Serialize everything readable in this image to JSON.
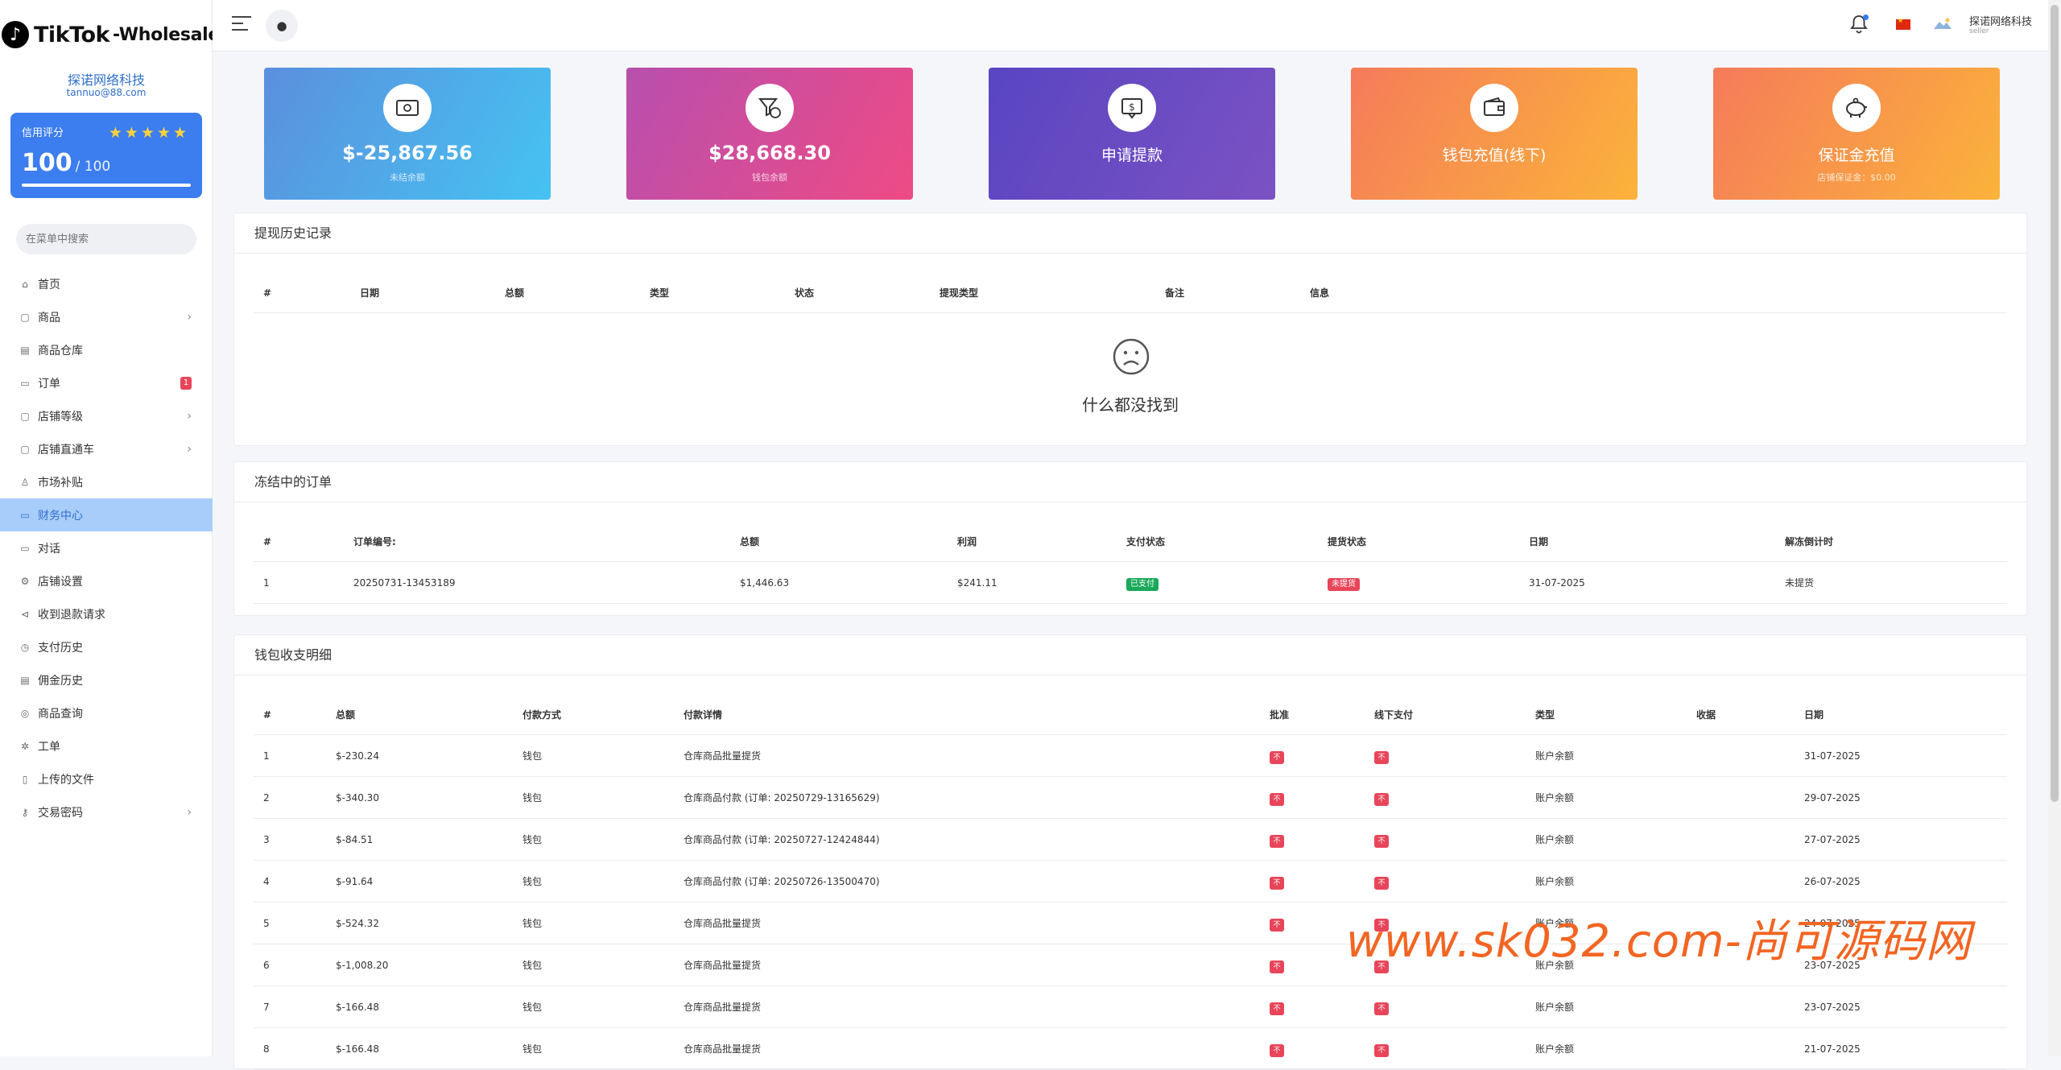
{
  "brand": {
    "word": "TikTok",
    "suffix": "-Wholesale"
  },
  "profile": {
    "name": "探诺网络科技",
    "email": "tannuo@88.com"
  },
  "credit": {
    "label": "信用评分",
    "stars": "★★★★★",
    "score": "100",
    "max": "/ 100",
    "progress_percent": 100
  },
  "search": {
    "placeholder": "在菜单中搜索"
  },
  "menu": [
    {
      "label": "首页",
      "icon": "home-icon",
      "glyph": "⌂"
    },
    {
      "label": "商品",
      "icon": "bag-icon",
      "glyph": "▢",
      "chevron": "›"
    },
    {
      "label": "商品仓库",
      "icon": "warehouse-icon",
      "glyph": "▤"
    },
    {
      "label": "订单",
      "icon": "order-icon",
      "glyph": "▭",
      "badge": "1"
    },
    {
      "label": "店铺等级",
      "icon": "level-icon",
      "glyph": "▢",
      "chevron": "›"
    },
    {
      "label": "店铺直通车",
      "icon": "promotion-icon",
      "glyph": "▢",
      "chevron": "›"
    },
    {
      "label": "市场补贴",
      "icon": "subsidy-icon",
      "glyph": "♙"
    },
    {
      "label": "财务中心",
      "icon": "finance-icon",
      "glyph": "▭",
      "active": true
    },
    {
      "label": "对话",
      "icon": "chat-icon",
      "glyph": "▭"
    },
    {
      "label": "店铺设置",
      "icon": "settings-icon",
      "glyph": "⚙"
    },
    {
      "label": "收到退款请求",
      "icon": "refund-icon",
      "glyph": "⊲"
    },
    {
      "label": "支付历史",
      "icon": "history-icon",
      "glyph": "◷"
    },
    {
      "label": "佣金历史",
      "icon": "commission-icon",
      "glyph": "▤"
    },
    {
      "label": "商品查询",
      "icon": "query-icon",
      "glyph": "◎"
    },
    {
      "label": "工单",
      "icon": "ticket-icon",
      "glyph": "✲"
    },
    {
      "label": "上传的文件",
      "icon": "file-icon",
      "glyph": "▯"
    },
    {
      "label": "交易密码",
      "icon": "key-icon",
      "glyph": "⚷",
      "chevron": "›"
    }
  ],
  "topbar": {
    "user_name": "探诺网络科技",
    "user_role": "seller"
  },
  "stats": [
    {
      "value": "$-25,867.56",
      "caption": "未结余额",
      "icon": "cash-icon",
      "gradient": [
        "#5b8fde",
        "#45c3f1"
      ]
    },
    {
      "value": "$28,668.30",
      "caption": "钱包余额",
      "icon": "funnel-dollar-icon",
      "gradient": [
        "#b84fae",
        "#ee4b84"
      ]
    },
    {
      "value": "申请提款",
      "caption": "",
      "icon": "withdraw-icon",
      "gradient": [
        "#5945c2",
        "#7b52c3"
      ]
    },
    {
      "value": "钱包充值(线下)",
      "caption": "",
      "icon": "wallet-icon",
      "gradient": [
        "#f57b5a",
        "#fbb33a"
      ]
    },
    {
      "value": "保证金充值",
      "caption": "店铺保证金：$0.00",
      "icon": "piggy-bank-icon",
      "gradient": [
        "#f57b5a",
        "#fbb33a"
      ]
    }
  ],
  "withdraw_history": {
    "title": "提现历史记录",
    "headers": [
      "#",
      "日期",
      "总额",
      "类型",
      "状态",
      "提现类型",
      "备注",
      "信息"
    ],
    "empty_text": "什么都没找到"
  },
  "frozen_orders": {
    "title": "冻结中的订单",
    "headers": [
      "#",
      "订单编号:",
      "总额",
      "利润",
      "支付状态",
      "提货状态",
      "日期",
      "解冻倒计时"
    ],
    "rows": [
      {
        "no": "1",
        "order": "20250731-13453189",
        "total": "$1,446.63",
        "profit": "$241.11",
        "pay_status": "已支付",
        "pickup_status": "未提货",
        "date": "31-07-2025",
        "countdown": "未提货"
      }
    ]
  },
  "wallet_detail": {
    "title": "钱包收支明细",
    "headers": [
      "#",
      "总额",
      "付款方式",
      "付款详情",
      "批准",
      "线下支付",
      "类型",
      "收据",
      "日期"
    ],
    "rows": [
      {
        "no": "1",
        "total": "$-230.24",
        "method": "钱包",
        "detail": "仓库商品批量提货",
        "approve": "不",
        "offline": "不",
        "type": "账户余额",
        "date": "31-07-2025"
      },
      {
        "no": "2",
        "total": "$-340.30",
        "method": "钱包",
        "detail": "仓库商品付款 (订单: 20250729-13165629)",
        "approve": "不",
        "offline": "不",
        "type": "账户余额",
        "date": "29-07-2025"
      },
      {
        "no": "3",
        "total": "$-84.51",
        "method": "钱包",
        "detail": "仓库商品付款 (订单: 20250727-12424844)",
        "approve": "不",
        "offline": "不",
        "type": "账户余额",
        "date": "27-07-2025"
      },
      {
        "no": "4",
        "total": "$-91.64",
        "method": "钱包",
        "detail": "仓库商品付款 (订单: 20250726-13500470)",
        "approve": "不",
        "offline": "不",
        "type": "账户余额",
        "date": "26-07-2025"
      },
      {
        "no": "5",
        "total": "$-524.32",
        "method": "钱包",
        "detail": "仓库商品批量提货",
        "approve": "不",
        "offline": "不",
        "type": "账户余额",
        "date": "24-07-2025"
      },
      {
        "no": "6",
        "total": "$-1,008.20",
        "method": "钱包",
        "detail": "仓库商品批量提货",
        "approve": "不",
        "offline": "不",
        "type": "账户余额",
        "date": "23-07-2025"
      },
      {
        "no": "7",
        "total": "$-166.48",
        "method": "钱包",
        "detail": "仓库商品批量提货",
        "approve": "不",
        "offline": "不",
        "type": "账户余额",
        "date": "23-07-2025"
      },
      {
        "no": "8",
        "total": "$-166.48",
        "method": "钱包",
        "detail": "仓库商品批量提货",
        "approve": "不",
        "offline": "不",
        "type": "账户余额",
        "date": "21-07-2025"
      }
    ]
  },
  "watermark": "www.sk032.com-尚可源码网"
}
